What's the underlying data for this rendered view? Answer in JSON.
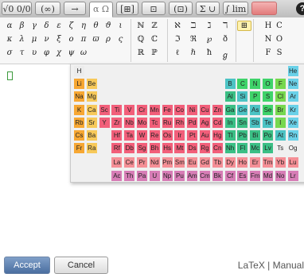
{
  "toolbar": {
    "tabs": [
      {
        "label": "√0 0/0",
        "active": false
      },
      {
        "label": "(∞)",
        "active": false
      },
      {
        "label": "→",
        "active": false
      },
      {
        "label": "α Ω",
        "active": true
      },
      {
        "label": "[⊞]",
        "active": false
      },
      {
        "label": "⊡",
        "active": false
      },
      {
        "label": "(⊡)",
        "active": false
      },
      {
        "label": "Σ ∪",
        "active": false
      },
      {
        "label": "∫ lim",
        "active": false
      },
      {
        "label": "",
        "active": false,
        "red": true
      }
    ],
    "help_label": "?"
  },
  "palette": {
    "greek_rows": [
      [
        "α",
        "β",
        "γ",
        "δ",
        "ε",
        "ζ",
        "η",
        "θ",
        "ϑ",
        "ι"
      ],
      [
        "κ",
        "λ",
        "μ",
        "ν",
        "ξ",
        "ο",
        "π",
        "ϖ",
        "ρ",
        "ς"
      ],
      [
        "σ",
        "τ",
        "υ",
        "φ",
        "χ",
        "ψ",
        "ω"
      ]
    ],
    "set_rows": [
      [
        "ℕ",
        "ℤ"
      ],
      [
        "ℚ",
        "ℂ"
      ],
      [
        "ℝ",
        "ℙ"
      ]
    ],
    "misc_rows": [
      [
        "ℵ",
        "ℶ",
        "ℷ",
        "ℸ"
      ],
      [
        "ℑ",
        "ℜ",
        "℘",
        "ð"
      ],
      [
        "ℓ",
        "ℏ",
        "ħ",
        "ℊ"
      ]
    ],
    "element_rows": [
      [
        "H",
        "C"
      ],
      [
        "N",
        "O"
      ],
      [
        "F",
        "S"
      ]
    ]
  },
  "periodic_table": {
    "colors": {
      "alkali": "#f7a733",
      "alkaline": "#f7c95a",
      "transition": "#f25f7a",
      "post_transition": "#3bbf85",
      "metalloid": "#4cc3c4",
      "nonmetal": "#3fd36a",
      "halogen": "#77d84f",
      "noble": "#6ad1e8",
      "lanthanide": "#f58f96",
      "actinide": "#d77db6",
      "hydrogen": "#ececec",
      "unknown": "#f0f0f0"
    },
    "elements": [
      {
        "s": "H",
        "r": 0,
        "c": 0,
        "k": "hydrogen"
      },
      {
        "s": "He",
        "r": 0,
        "c": 17,
        "k": "noble"
      },
      {
        "s": "Li",
        "r": 1,
        "c": 0,
        "k": "alkali"
      },
      {
        "s": "Be",
        "r": 1,
        "c": 1,
        "k": "alkaline"
      },
      {
        "s": "B",
        "r": 1,
        "c": 12,
        "k": "metalloid"
      },
      {
        "s": "C",
        "r": 1,
        "c": 13,
        "k": "nonmetal"
      },
      {
        "s": "N",
        "r": 1,
        "c": 14,
        "k": "nonmetal"
      },
      {
        "s": "O",
        "r": 1,
        "c": 15,
        "k": "nonmetal"
      },
      {
        "s": "F",
        "r": 1,
        "c": 16,
        "k": "halogen"
      },
      {
        "s": "Ne",
        "r": 1,
        "c": 17,
        "k": "noble"
      },
      {
        "s": "Na",
        "r": 2,
        "c": 0,
        "k": "alkali"
      },
      {
        "s": "Mg",
        "r": 2,
        "c": 1,
        "k": "alkaline"
      },
      {
        "s": "Al",
        "r": 2,
        "c": 12,
        "k": "post_transition"
      },
      {
        "s": "Si",
        "r": 2,
        "c": 13,
        "k": "metalloid"
      },
      {
        "s": "P",
        "r": 2,
        "c": 14,
        "k": "nonmetal"
      },
      {
        "s": "S",
        "r": 2,
        "c": 15,
        "k": "nonmetal"
      },
      {
        "s": "Cl",
        "r": 2,
        "c": 16,
        "k": "halogen"
      },
      {
        "s": "Ar",
        "r": 2,
        "c": 17,
        "k": "noble"
      },
      {
        "s": "K",
        "r": 3,
        "c": 0,
        "k": "alkali"
      },
      {
        "s": "Ca",
        "r": 3,
        "c": 1,
        "k": "alkaline"
      },
      {
        "s": "Sc",
        "r": 3,
        "c": 2,
        "k": "transition"
      },
      {
        "s": "Ti",
        "r": 3,
        "c": 3,
        "k": "transition"
      },
      {
        "s": "V",
        "r": 3,
        "c": 4,
        "k": "transition"
      },
      {
        "s": "Cr",
        "r": 3,
        "c": 5,
        "k": "transition"
      },
      {
        "s": "Mn",
        "r": 3,
        "c": 6,
        "k": "transition"
      },
      {
        "s": "Fe",
        "r": 3,
        "c": 7,
        "k": "transition"
      },
      {
        "s": "Co",
        "r": 3,
        "c": 8,
        "k": "transition"
      },
      {
        "s": "Ni",
        "r": 3,
        "c": 9,
        "k": "transition"
      },
      {
        "s": "Cu",
        "r": 3,
        "c": 10,
        "k": "transition"
      },
      {
        "s": "Zn",
        "r": 3,
        "c": 11,
        "k": "transition"
      },
      {
        "s": "Ga",
        "r": 3,
        "c": 12,
        "k": "post_transition"
      },
      {
        "s": "Ge",
        "r": 3,
        "c": 13,
        "k": "metalloid"
      },
      {
        "s": "As",
        "r": 3,
        "c": 14,
        "k": "metalloid"
      },
      {
        "s": "Se",
        "r": 3,
        "c": 15,
        "k": "nonmetal"
      },
      {
        "s": "Br",
        "r": 3,
        "c": 16,
        "k": "halogen"
      },
      {
        "s": "Kr",
        "r": 3,
        "c": 17,
        "k": "noble"
      },
      {
        "s": "Rb",
        "r": 4,
        "c": 0,
        "k": "alkali"
      },
      {
        "s": "Sr",
        "r": 4,
        "c": 1,
        "k": "alkaline"
      },
      {
        "s": "Y",
        "r": 4,
        "c": 2,
        "k": "transition"
      },
      {
        "s": "Zr",
        "r": 4,
        "c": 3,
        "k": "transition"
      },
      {
        "s": "Nb",
        "r": 4,
        "c": 4,
        "k": "transition"
      },
      {
        "s": "Mo",
        "r": 4,
        "c": 5,
        "k": "transition"
      },
      {
        "s": "Tc",
        "r": 4,
        "c": 6,
        "k": "transition"
      },
      {
        "s": "Ru",
        "r": 4,
        "c": 7,
        "k": "transition"
      },
      {
        "s": "Rh",
        "r": 4,
        "c": 8,
        "k": "transition"
      },
      {
        "s": "Pd",
        "r": 4,
        "c": 9,
        "k": "transition"
      },
      {
        "s": "Ag",
        "r": 4,
        "c": 10,
        "k": "transition"
      },
      {
        "s": "Cd",
        "r": 4,
        "c": 11,
        "k": "transition"
      },
      {
        "s": "In",
        "r": 4,
        "c": 12,
        "k": "post_transition"
      },
      {
        "s": "Sn",
        "r": 4,
        "c": 13,
        "k": "post_transition"
      },
      {
        "s": "Sb",
        "r": 4,
        "c": 14,
        "k": "metalloid"
      },
      {
        "s": "Te",
        "r": 4,
        "c": 15,
        "k": "metalloid"
      },
      {
        "s": "I",
        "r": 4,
        "c": 16,
        "k": "halogen"
      },
      {
        "s": "Xe",
        "r": 4,
        "c": 17,
        "k": "noble"
      },
      {
        "s": "Cs",
        "r": 5,
        "c": 0,
        "k": "alkali"
      },
      {
        "s": "Ba",
        "r": 5,
        "c": 1,
        "k": "alkaline"
      },
      {
        "s": "Hf",
        "r": 5,
        "c": 3,
        "k": "transition"
      },
      {
        "s": "Ta",
        "r": 5,
        "c": 4,
        "k": "transition"
      },
      {
        "s": "W",
        "r": 5,
        "c": 5,
        "k": "transition"
      },
      {
        "s": "Re",
        "r": 5,
        "c": 6,
        "k": "transition"
      },
      {
        "s": "Os",
        "r": 5,
        "c": 7,
        "k": "transition"
      },
      {
        "s": "Ir",
        "r": 5,
        "c": 8,
        "k": "transition"
      },
      {
        "s": "Pt",
        "r": 5,
        "c": 9,
        "k": "transition"
      },
      {
        "s": "Au",
        "r": 5,
        "c": 10,
        "k": "transition"
      },
      {
        "s": "Hg",
        "r": 5,
        "c": 11,
        "k": "transition"
      },
      {
        "s": "Tl",
        "r": 5,
        "c": 12,
        "k": "post_transition"
      },
      {
        "s": "Pb",
        "r": 5,
        "c": 13,
        "k": "post_transition"
      },
      {
        "s": "Bi",
        "r": 5,
        "c": 14,
        "k": "post_transition"
      },
      {
        "s": "Po",
        "r": 5,
        "c": 15,
        "k": "post_transition"
      },
      {
        "s": "At",
        "r": 5,
        "c": 16,
        "k": "metalloid"
      },
      {
        "s": "Rn",
        "r": 5,
        "c": 17,
        "k": "noble"
      },
      {
        "s": "Fr",
        "r": 6,
        "c": 0,
        "k": "alkali"
      },
      {
        "s": "Ra",
        "r": 6,
        "c": 1,
        "k": "alkaline"
      },
      {
        "s": "Rf",
        "r": 6,
        "c": 3,
        "k": "transition"
      },
      {
        "s": "Db",
        "r": 6,
        "c": 4,
        "k": "transition"
      },
      {
        "s": "Sg",
        "r": 6,
        "c": 5,
        "k": "transition"
      },
      {
        "s": "Bh",
        "r": 6,
        "c": 6,
        "k": "transition"
      },
      {
        "s": "Hs",
        "r": 6,
        "c": 7,
        "k": "transition"
      },
      {
        "s": "Mt",
        "r": 6,
        "c": 8,
        "k": "transition"
      },
      {
        "s": "Ds",
        "r": 6,
        "c": 9,
        "k": "transition"
      },
      {
        "s": "Rg",
        "r": 6,
        "c": 10,
        "k": "transition"
      },
      {
        "s": "Cn",
        "r": 6,
        "c": 11,
        "k": "transition"
      },
      {
        "s": "Nh",
        "r": 6,
        "c": 12,
        "k": "post_transition"
      },
      {
        "s": "Fl",
        "r": 6,
        "c": 13,
        "k": "post_transition"
      },
      {
        "s": "Mc",
        "r": 6,
        "c": 14,
        "k": "post_transition"
      },
      {
        "s": "Lv",
        "r": 6,
        "c": 15,
        "k": "post_transition"
      },
      {
        "s": "Ts",
        "r": 6,
        "c": 16,
        "k": "unknown"
      },
      {
        "s": "Og",
        "r": 6,
        "c": 17,
        "k": "unknown"
      },
      {
        "s": "La",
        "r": 7,
        "c": 3,
        "k": "lanthanide"
      },
      {
        "s": "Ce",
        "r": 7,
        "c": 4,
        "k": "lanthanide"
      },
      {
        "s": "Pr",
        "r": 7,
        "c": 5,
        "k": "lanthanide"
      },
      {
        "s": "Nd",
        "r": 7,
        "c": 6,
        "k": "lanthanide"
      },
      {
        "s": "Pm",
        "r": 7,
        "c": 7,
        "k": "lanthanide"
      },
      {
        "s": "Sm",
        "r": 7,
        "c": 8,
        "k": "lanthanide"
      },
      {
        "s": "Eu",
        "r": 7,
        "c": 9,
        "k": "lanthanide"
      },
      {
        "s": "Gd",
        "r": 7,
        "c": 10,
        "k": "lanthanide"
      },
      {
        "s": "Tb",
        "r": 7,
        "c": 11,
        "k": "lanthanide"
      },
      {
        "s": "Dy",
        "r": 7,
        "c": 12,
        "k": "lanthanide"
      },
      {
        "s": "Ho",
        "r": 7,
        "c": 13,
        "k": "lanthanide"
      },
      {
        "s": "Er",
        "r": 7,
        "c": 14,
        "k": "lanthanide"
      },
      {
        "s": "Tm",
        "r": 7,
        "c": 15,
        "k": "lanthanide"
      },
      {
        "s": "Yb",
        "r": 7,
        "c": 16,
        "k": "lanthanide"
      },
      {
        "s": "Lu",
        "r": 7,
        "c": 17,
        "k": "lanthanide"
      },
      {
        "s": "Ac",
        "r": 8,
        "c": 3,
        "k": "actinide"
      },
      {
        "s": "Th",
        "r": 8,
        "c": 4,
        "k": "actinide"
      },
      {
        "s": "Pa",
        "r": 8,
        "c": 5,
        "k": "actinide"
      },
      {
        "s": "U",
        "r": 8,
        "c": 6,
        "k": "actinide"
      },
      {
        "s": "Np",
        "r": 8,
        "c": 7,
        "k": "actinide"
      },
      {
        "s": "Pu",
        "r": 8,
        "c": 8,
        "k": "actinide"
      },
      {
        "s": "Am",
        "r": 8,
        "c": 9,
        "k": "actinide"
      },
      {
        "s": "Cm",
        "r": 8,
        "c": 10,
        "k": "actinide"
      },
      {
        "s": "Bk",
        "r": 8,
        "c": 11,
        "k": "actinide"
      },
      {
        "s": "Cf",
        "r": 8,
        "c": 12,
        "k": "actinide"
      },
      {
        "s": "Es",
        "r": 8,
        "c": 13,
        "k": "actinide"
      },
      {
        "s": "Fm",
        "r": 8,
        "c": 14,
        "k": "actinide"
      },
      {
        "s": "Md",
        "r": 8,
        "c": 15,
        "k": "actinide"
      },
      {
        "s": "No",
        "r": 8,
        "c": 16,
        "k": "actinide"
      },
      {
        "s": "Lr",
        "r": 8,
        "c": 17,
        "k": "actinide"
      }
    ]
  },
  "footer": {
    "accept_label": "Accept",
    "cancel_label": "Cancel",
    "latex_label": "LaTeX",
    "separator": "|",
    "manual_label": "Manual"
  }
}
